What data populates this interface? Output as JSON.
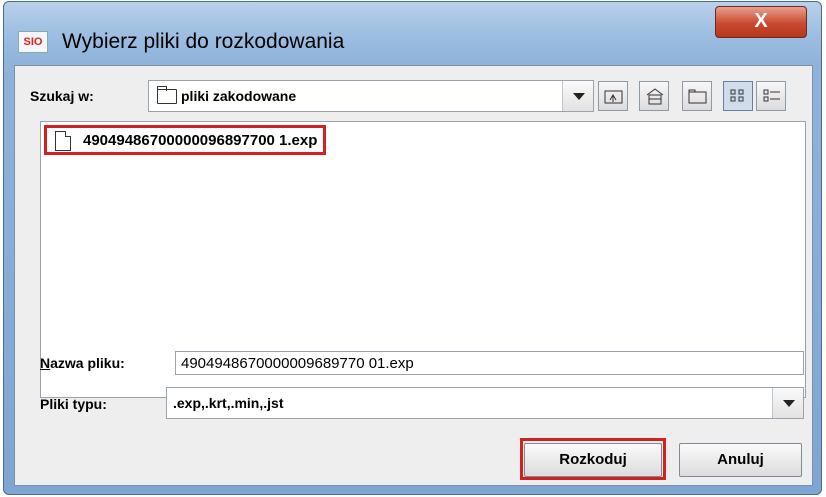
{
  "window": {
    "app_icon_text": "SIO",
    "title": "Wybierz pliki do rozkodowania",
    "close_label": "X"
  },
  "look_in": {
    "label": "Szukaj w:",
    "value": "pliki zakodowane"
  },
  "toolbar": {
    "icons": [
      "up-folder-icon",
      "home-icon",
      "new-folder-icon",
      "list-view-icon",
      "details-view-icon"
    ]
  },
  "files": [
    {
      "name": "49049486700000096897700 1.exp"
    }
  ],
  "file_name": {
    "label_first": "N",
    "label_rest": "azwa pliku:",
    "value": "4904948670000009689770 01.exp"
  },
  "file_type": {
    "label": "Pliki typu:",
    "value": ".exp,.krt,.min,.jst"
  },
  "buttons": {
    "decode": "Rozkoduj",
    "cancel": "Anuluj"
  },
  "colors": {
    "highlight": "#d32020",
    "title_bar": "#9fbfe2"
  }
}
